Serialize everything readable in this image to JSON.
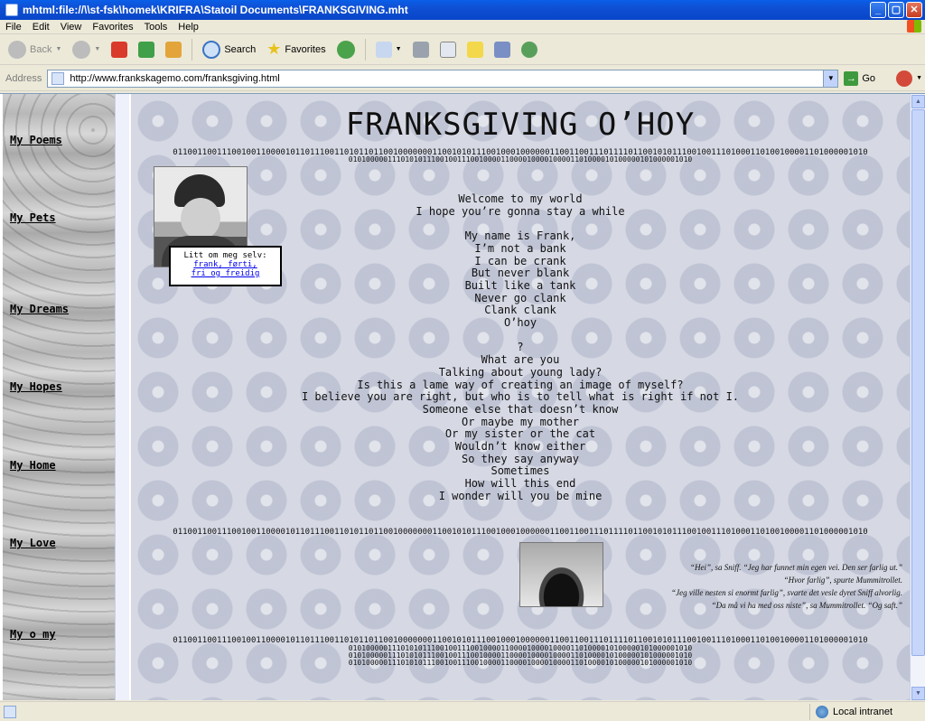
{
  "window": {
    "title": "mhtml:file://\\\\st-fsk\\homek\\KRIFRA\\Statoil Documents\\FRANKSGIVING.mht"
  },
  "menu": [
    "File",
    "Edit",
    "View",
    "Favorites",
    "Tools",
    "Help"
  ],
  "toolbar": {
    "back": "Back",
    "search": "Search",
    "favorites": "Favorites"
  },
  "address": {
    "label": "Address",
    "url": "http://www.frankskagemo.com/franksgiving.html",
    "go": "Go"
  },
  "sidebar": [
    "My Poems",
    "My Pets",
    "My Dreams",
    "My Hopes",
    "My Home",
    "My Love",
    "My o my"
  ],
  "page": {
    "title": "FRANKSGIVING O’HOY",
    "binary_long": "0110011001110010011000010110111001101011011001000000011001010111001000100000011001100111011110110010101110010011101000110100100001101000001010",
    "binary_short": "0101000001110101011100100111001000011000010000100001101000010100000101000001010",
    "info_label": "Litt om meg selv:",
    "info_link_line1": "frank, førti,",
    "info_link_line2": "fri og freidig",
    "poem": [
      "Welcome to my world",
      "I hope you’re gonna stay a while",
      "",
      "My name is Frank,",
      "I’m not a bank",
      "I can be crank",
      "But never blank",
      "Built like a tank",
      "Never go clank",
      "Clank clank",
      "O’hoy",
      "",
      "?",
      "What are you",
      "Talking about young lady?",
      "Is this a lame way of creating an image of myself?",
      "I believe you are right, but who is to tell what is right if not I.",
      "Someone else that doesn’t know",
      "Or maybe my mother",
      "Or my sister or the cat",
      "Wouldn’t know either",
      "So they say anyway",
      "Sometimes",
      "How will this end",
      "I wonder will you be mine"
    ],
    "quote": [
      "“Hei”, sa Sniff. “Jeg har funnet min egen vei. Den ser farlig ut.”",
      "“Hvor farlig”, spurte Mummitrollet.",
      "“Jeg ville nesten si enormt farlig”, svarte det vesle dyret Sniff alvorlig.",
      "“Da må vi ha med oss niste”, sa Mummitrollet. “Og saft.”"
    ]
  },
  "status": {
    "zone": "Local intranet"
  },
  "colors": {
    "titlebar": "#0a5fe8",
    "link": "#0000ee",
    "content_bg": "#d6d9e4"
  }
}
